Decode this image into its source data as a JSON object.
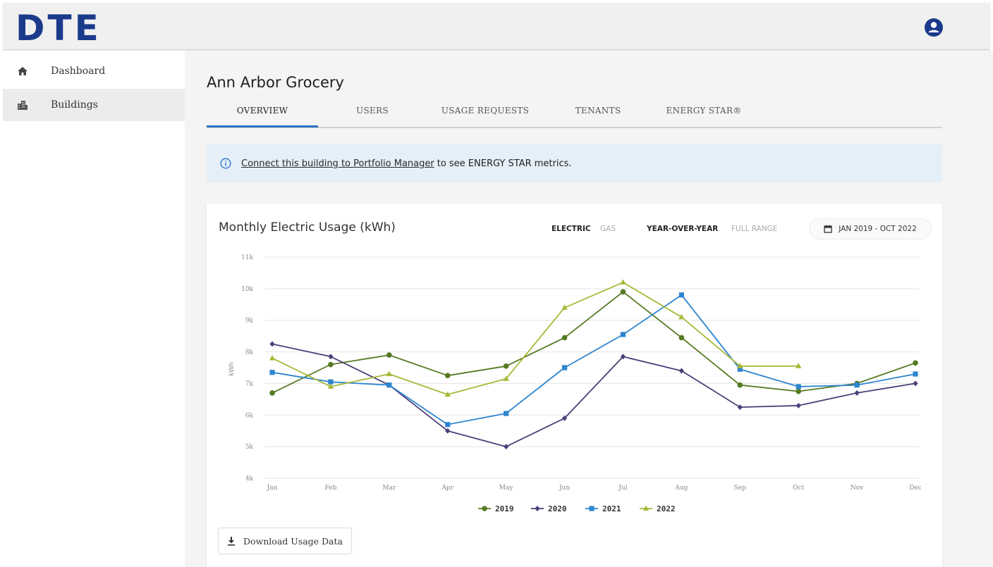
{
  "header": {
    "logo": "DTE"
  },
  "sidebar": {
    "items": [
      {
        "label": "Dashboard"
      },
      {
        "label": "Buildings"
      }
    ]
  },
  "page": {
    "title": "Ann Arbor Grocery",
    "tabs": [
      {
        "label": "OVERVIEW"
      },
      {
        "label": "USERS"
      },
      {
        "label": "USAGE REQUESTS"
      },
      {
        "label": "TENANTS"
      },
      {
        "label": "ENERGY STAR®"
      }
    ]
  },
  "banner": {
    "link_text": "Connect this building to Portfolio Manager",
    "text": "to see ENERGY STAR metrics."
  },
  "card": {
    "title": "Monthly Electric Usage (kWh)",
    "toggles": {
      "electric": "ELECTRIC",
      "gas": "GAS",
      "year_over_year": "YEAR-OVER-YEAR",
      "full_range": "FULL RANGE"
    },
    "date_range": "JAN 2019 - OCT 2022",
    "download_label": "Download Usage Data"
  },
  "chart_data": {
    "type": "line",
    "title": "Monthly Electric Usage (kWh)",
    "ylabel": "kWh",
    "xlabel": "",
    "categories": [
      "Jan",
      "Feb",
      "Mar",
      "Apr",
      "May",
      "Jun",
      "Jul",
      "Aug",
      "Sep",
      "Oct",
      "Nov",
      "Dec"
    ],
    "ylim": [
      4000,
      11000
    ],
    "yticks": [
      "4k",
      "5k",
      "6k",
      "7k",
      "8k",
      "9k",
      "10k",
      "11k"
    ],
    "grid": true,
    "legend": "bottom-center",
    "series": [
      {
        "name": "2019",
        "color": "#557a22",
        "marker": "circle",
        "values": [
          6700,
          7600,
          7900,
          7250,
          7550,
          8450,
          9900,
          8450,
          6950,
          6750,
          7000,
          7650
        ]
      },
      {
        "name": "2020",
        "color": "#4d3f7a",
        "marker": "diamond",
        "values": [
          8250,
          7850,
          6950,
          5500,
          5000,
          5900,
          7850,
          7400,
          6250,
          6300,
          6700,
          7000
        ]
      },
      {
        "name": "2021",
        "color": "#2d85cf",
        "marker": "square",
        "values": [
          7350,
          7050,
          6950,
          5700,
          6050,
          7500,
          8550,
          9800,
          7450,
          6900,
          6950,
          7300
        ]
      },
      {
        "name": "2022",
        "color": "#a8b838",
        "marker": "triangle",
        "values": [
          7800,
          6900,
          7300,
          6650,
          7150,
          9400,
          10200,
          9100,
          7550,
          7550
        ]
      }
    ]
  }
}
